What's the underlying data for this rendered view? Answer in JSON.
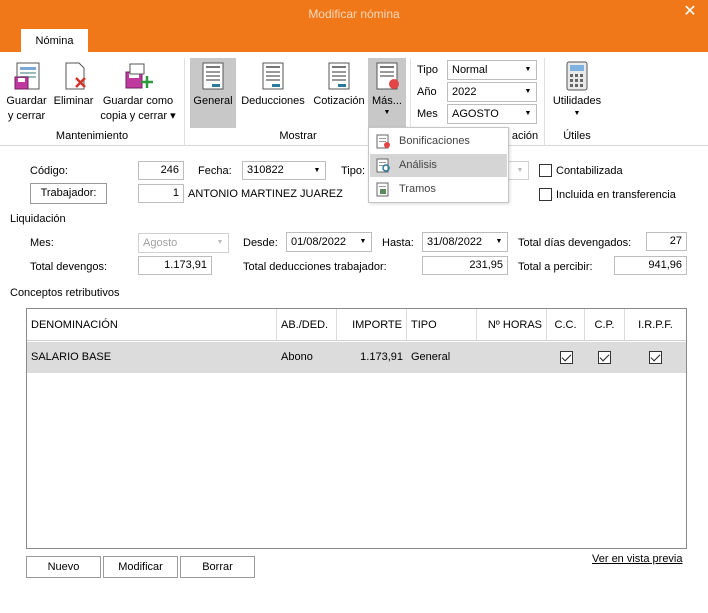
{
  "window": {
    "title": "Modificar nómina",
    "close_glyph": "✕"
  },
  "ribbon": {
    "tab": "Nómina",
    "buttons": {
      "guardar": "Guardar y cerrar",
      "eliminar": "Eliminar",
      "guardar_copia": "Guardar como copia y cerrar ▾",
      "general": "General",
      "deducciones": "Deducciones",
      "cotizacion": "Cotización",
      "mas": "Más...",
      "utilidades": "Utilidades"
    },
    "groups": {
      "mantenimiento": "Mantenimiento",
      "mostrar": "Mostrar",
      "liquidacion_partial": "ación",
      "utiles": "Útiles"
    },
    "selectors": {
      "tipo_label": "Tipo",
      "tipo_value": "Normal",
      "anio_label": "Año",
      "anio_value": "2022",
      "mes_label": "Mes",
      "mes_value": "AGOSTO"
    }
  },
  "dropdown_menu": {
    "items": [
      "Bonificaciones",
      "Análisis",
      "Tramos"
    ],
    "highlighted": "Análisis"
  },
  "form": {
    "codigo_label": "Código:",
    "codigo_value": "246",
    "fecha_label": "Fecha:",
    "fecha_value": "310822",
    "tipo_label": "Tipo:",
    "trabajador_button": "Trabajador:",
    "trabajador_id": "1",
    "trabajador_name": "ANTONIO MARTINEZ JUAREZ",
    "contabilizada_label": "Contabilizada",
    "transferencia_label": "Incluida en transferencia",
    "liquidacion_header": "Liquidación",
    "mes_label": "Mes:",
    "mes_value": "Agosto",
    "desde_label": "Desde:",
    "desde_value": "01/08/2022",
    "hasta_label": "Hasta:",
    "hasta_value": "31/08/2022",
    "dias_label": "Total días devengados:",
    "dias_value": "27",
    "devengos_label": "Total devengos:",
    "devengos_value": "1.173,91",
    "deducciones_label": "Total deducciones trabajador:",
    "deducciones_value": "231,95",
    "percibir_label": "Total a percibir:",
    "percibir_value": "941,96",
    "conceptos_header": "Conceptos retributivos"
  },
  "table": {
    "columns": [
      "DENOMINACIÓN",
      "AB./DED.",
      "IMPORTE",
      "TIPO",
      "Nº HORAS",
      "C.C.",
      "C.P.",
      "I.R.P.F."
    ],
    "rows": [
      {
        "denominacion": "SALARIO BASE",
        "ab_ded": "Abono",
        "importe": "1.173,91",
        "tipo": "General",
        "horas": "",
        "cc": true,
        "cp": true,
        "irpf": true
      }
    ]
  },
  "footer": {
    "nuevo": "Nuevo",
    "modificar": "Modificar",
    "borrar": "Borrar",
    "vista_previa": "Ver en vista previa"
  },
  "colors": {
    "titlebar": "#f07819",
    "highlight": "#c8c8c8"
  }
}
